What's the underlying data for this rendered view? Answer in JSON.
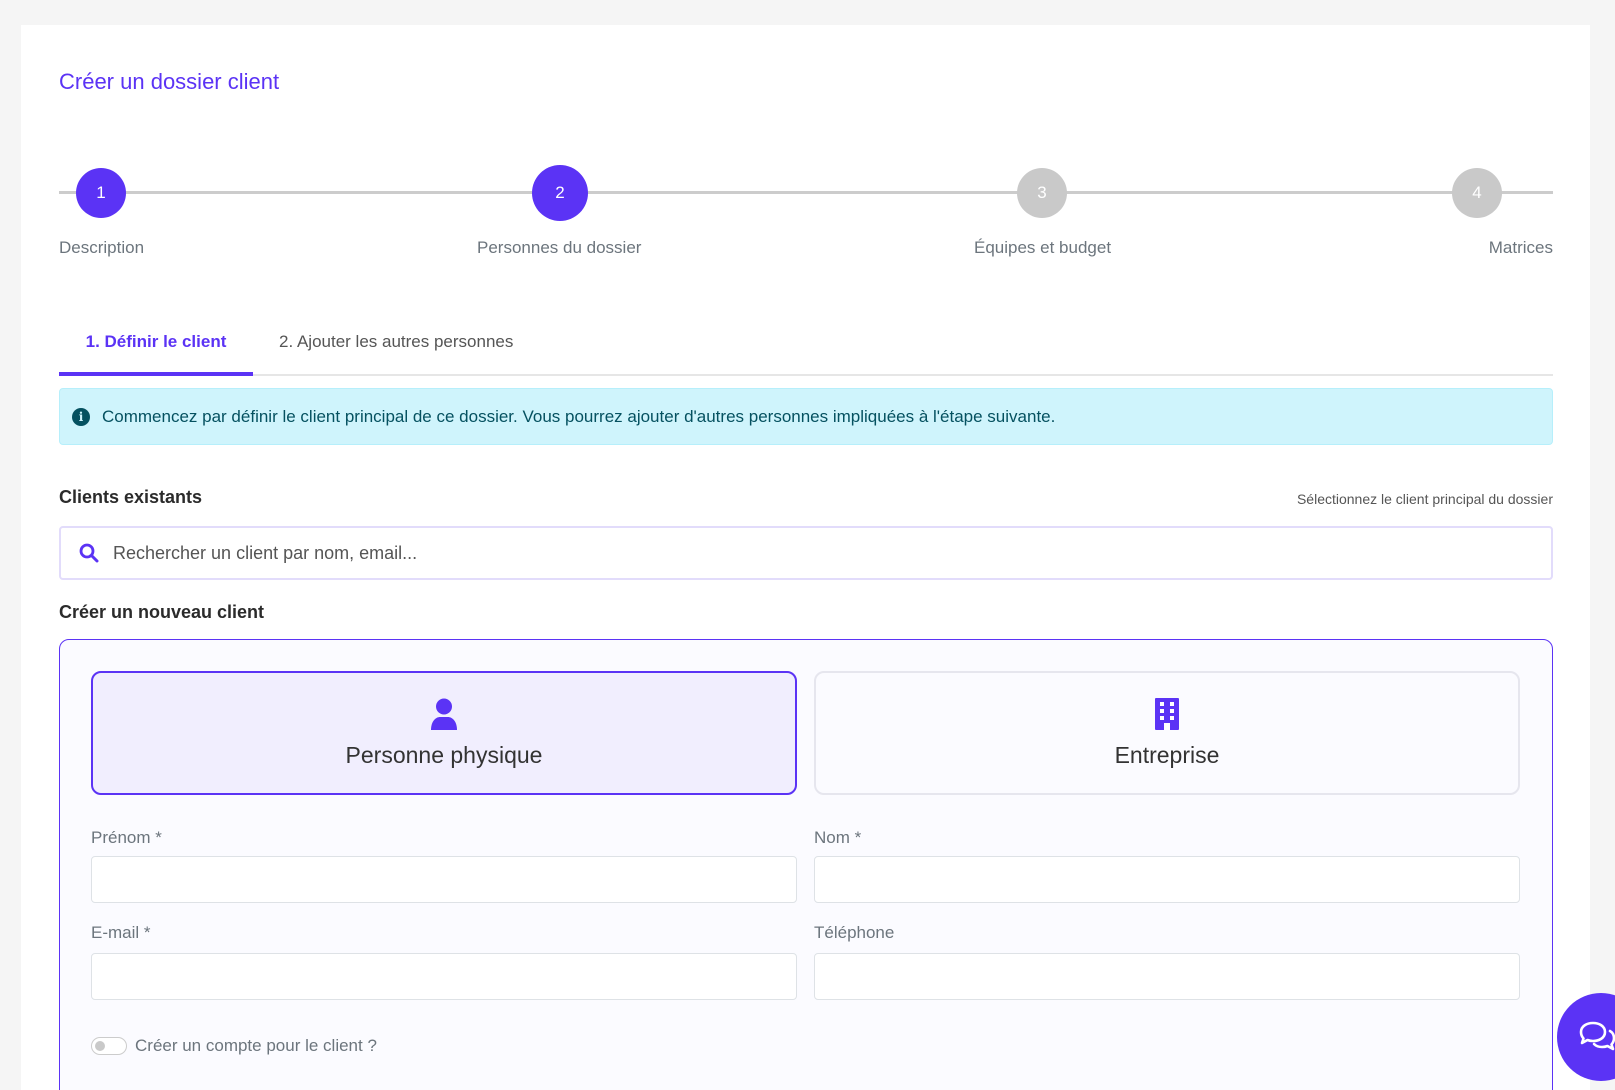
{
  "page": {
    "title": "Créer un dossier client"
  },
  "stepper": {
    "steps": [
      {
        "number": "1",
        "label": "Description",
        "state": "done"
      },
      {
        "number": "2",
        "label": "Personnes du dossier",
        "state": "active"
      },
      {
        "number": "3",
        "label": "Équipes et budget",
        "state": "todo"
      },
      {
        "number": "4",
        "label": "Matrices",
        "state": "todo"
      }
    ]
  },
  "tabs": [
    {
      "label": "1. Définir le client",
      "active": true
    },
    {
      "label": "2. Ajouter les autres personnes",
      "active": false
    }
  ],
  "alert": {
    "icon": "info-circle-icon",
    "text": "Commencez par définir le client principal de ce dossier. Vous pourrez ajouter d'autres personnes impliquées à l'étape suivante."
  },
  "existing_clients": {
    "title": "Clients existants",
    "hint": "Sélectionnez le client principal du dossier",
    "search_placeholder": "Rechercher un client par nom, email..."
  },
  "new_client": {
    "title": "Créer un nouveau client",
    "types": [
      {
        "label": "Personne physique",
        "icon": "user-icon",
        "selected": true
      },
      {
        "label": "Entreprise",
        "icon": "building-icon",
        "selected": false
      }
    ],
    "fields": {
      "first_name_label": "Prénom *",
      "last_name_label": "Nom *",
      "email_label": "E-mail *",
      "phone_label": "Téléphone"
    },
    "create_account_label": "Créer un compte pour le client ?"
  },
  "colors": {
    "accent": "#5b33f5",
    "inactive_step": "#c9c9c9",
    "alert_bg": "#cff4fc",
    "alert_text": "#055160"
  }
}
